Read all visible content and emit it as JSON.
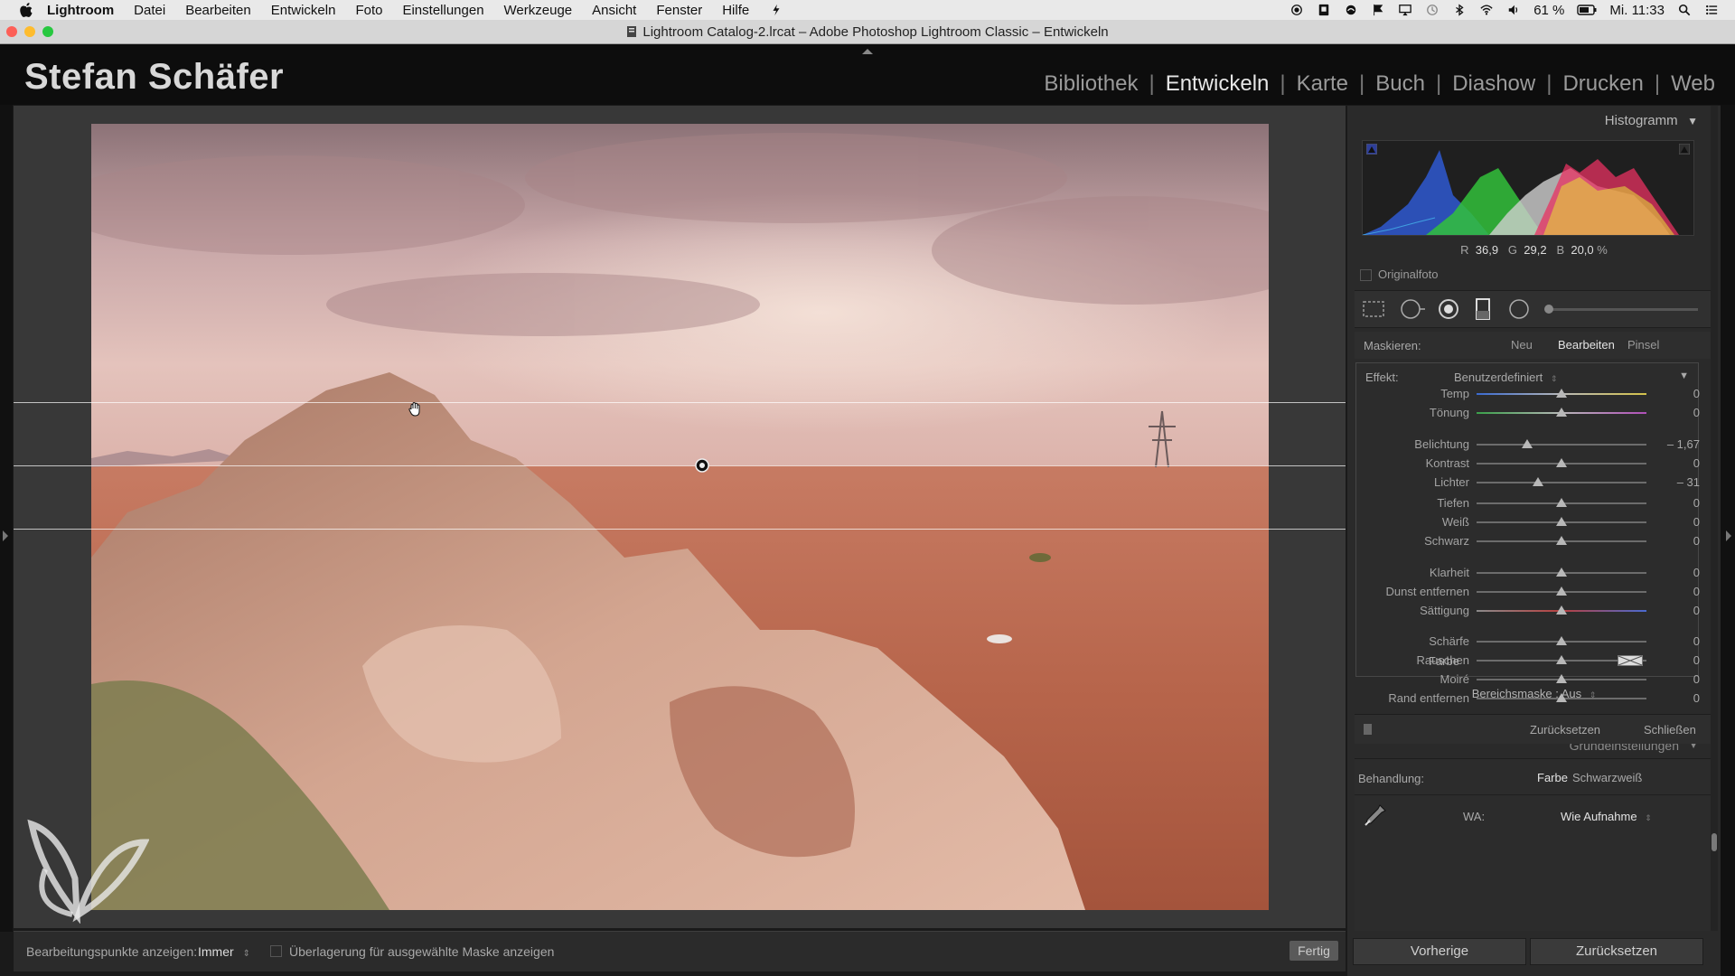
{
  "menubar": {
    "app": "Lightroom",
    "items": [
      "Datei",
      "Bearbeiten",
      "Entwickeln",
      "Foto",
      "Einstellungen",
      "Werkzeuge",
      "Ansicht",
      "Fenster",
      "Hilfe"
    ],
    "battery": "61 %",
    "clock": "Mi. 11:33"
  },
  "window": {
    "title": "Lightroom Catalog-2.lrcat – Adobe Photoshop Lightroom Classic – Entwickeln"
  },
  "identity_plate": "Stefan Schäfer",
  "modules": [
    "Bibliothek",
    "Entwickeln",
    "Karte",
    "Buch",
    "Diashow",
    "Drucken",
    "Web"
  ],
  "active_module": "Entwickeln",
  "histogram": {
    "title": "Histogramm",
    "readout": {
      "r_label": "R",
      "r": "36,9",
      "g_label": "G",
      "g": "29,2",
      "b_label": "B",
      "b": "20,0",
      "unit": "%"
    },
    "original_label": "Originalfoto"
  },
  "mask": {
    "label": "Maskieren:",
    "tabs": [
      "Neu",
      "Bearbeiten",
      "Pinsel"
    ],
    "active_tab": "Bearbeiten",
    "effect_label": "Effekt:",
    "effect_value": "Benutzerdefiniert",
    "sliders": [
      {
        "label": "Temp",
        "value": "0",
        "pos": 0.5
      },
      {
        "label": "Tönung",
        "value": "0",
        "pos": 0.5
      },
      {
        "label": "Belichtung",
        "value": "– 1,67",
        "pos": 0.3
      },
      {
        "label": "Kontrast",
        "value": "0",
        "pos": 0.5
      },
      {
        "label": "Lichter",
        "value": "– 31",
        "pos": 0.36
      },
      {
        "label": "Tiefen",
        "value": "0",
        "pos": 0.5
      },
      {
        "label": "Weiß",
        "value": "0",
        "pos": 0.5
      },
      {
        "label": "Schwarz",
        "value": "0",
        "pos": 0.5
      },
      {
        "label": "Klarheit",
        "value": "0",
        "pos": 0.5
      },
      {
        "label": "Dunst entfernen",
        "value": "0",
        "pos": 0.5
      },
      {
        "label": "Sättigung",
        "value": "0",
        "pos": 0.5
      },
      {
        "label": "Schärfe",
        "value": "0",
        "pos": 0.5
      },
      {
        "label": "Rauschen",
        "value": "0",
        "pos": 0.5
      },
      {
        "label": "Moiré",
        "value": "0",
        "pos": 0.5
      },
      {
        "label": "Rand entfernen",
        "value": "0",
        "pos": 0.5
      }
    ],
    "color_label": "Farbe",
    "range_mask": "Bereichsmaske : Aus",
    "reset": "Zurücksetzen",
    "close": "Schließen"
  },
  "basic": {
    "section_title": "Grundeinstellungen",
    "treatment_label": "Behandlung:",
    "treatment_color": "Farbe",
    "treatment_bw": "Schwarzweiß",
    "wb_label": "WA:",
    "wb_value": "Wie Aufnahme"
  },
  "bottom_buttons": {
    "previous": "Vorherige",
    "reset": "Zurücksetzen"
  },
  "viewer_toolbar": {
    "show_points_label": "Bearbeitungspunkte anzeigen:",
    "show_points_value": "Immer",
    "overlay_label": "Überlagerung für ausgewählte Maske anzeigen",
    "done": "Fertig"
  }
}
